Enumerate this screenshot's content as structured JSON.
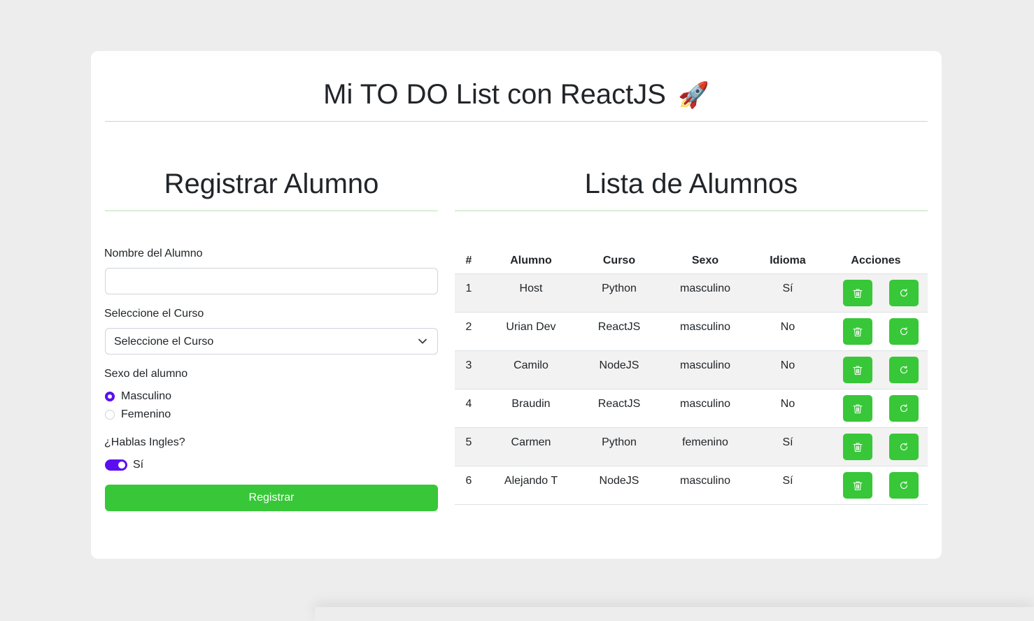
{
  "header": {
    "title": "Mi TO DO List con ReactJS",
    "title_emoji": "🚀"
  },
  "form": {
    "section_title": "Registrar Alumno",
    "name_label": "Nombre del Alumno",
    "name_value": "",
    "course_label": "Seleccione el Curso",
    "course_selected": "Seleccione el Curso",
    "sex_label": "Sexo del alumno",
    "sex_options": [
      {
        "label": "Masculino",
        "checked": true
      },
      {
        "label": "Femenino",
        "checked": false
      }
    ],
    "english_label": "¿Hablas Ingles?",
    "english_switch_label": "Sí",
    "english_on": true,
    "submit_label": "Registrar"
  },
  "list": {
    "section_title": "Lista de Alumnos",
    "columns": [
      "#",
      "Alumno",
      "Curso",
      "Sexo",
      "Idioma",
      "Acciones"
    ],
    "rows": [
      {
        "num": "1",
        "alumno": "Host",
        "curso": "Python",
        "sexo": "masculino",
        "idioma": "Sí"
      },
      {
        "num": "2",
        "alumno": "Urian Dev",
        "curso": "ReactJS",
        "sexo": "masculino",
        "idioma": "No"
      },
      {
        "num": "3",
        "alumno": "Camilo",
        "curso": "NodeJS",
        "sexo": "masculino",
        "idioma": "No"
      },
      {
        "num": "4",
        "alumno": "Braudin",
        "curso": "ReactJS",
        "sexo": "masculino",
        "idioma": "No"
      },
      {
        "num": "5",
        "alumno": "Carmen",
        "curso": "Python",
        "sexo": "femenino",
        "idioma": "Sí"
      },
      {
        "num": "6",
        "alumno": "Alejando T",
        "curso": "NodeJS",
        "sexo": "masculino",
        "idioma": "Sí"
      }
    ],
    "actions": [
      "trash-icon",
      "refresh-icon"
    ]
  },
  "colors": {
    "accent_green": "#38c738",
    "accent_purple": "#5b0ff0",
    "rule_green": "#b7e4b1"
  }
}
